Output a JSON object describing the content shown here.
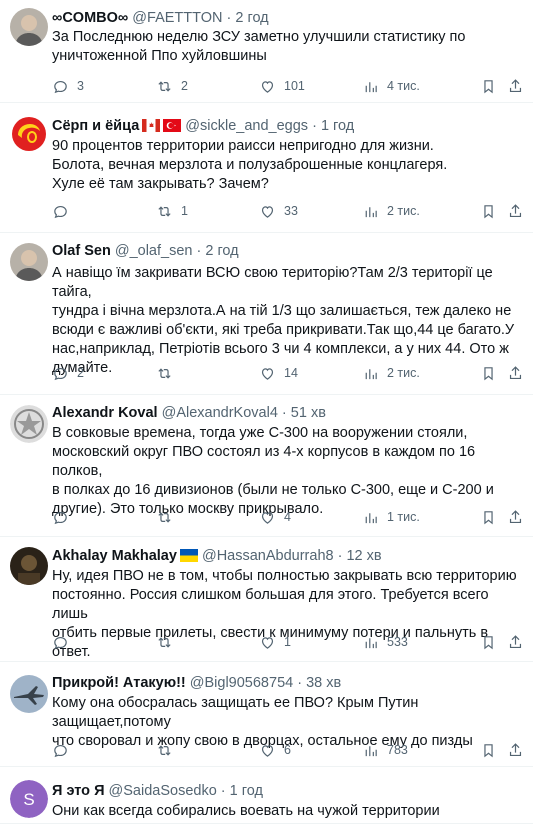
{
  "tweets": [
    {
      "name": "∞COMBO∞",
      "handle": "@FAETTTON",
      "time": "2 год",
      "lines": [
        "За Последнюю неделю ЗСУ заметно улучшили статистику по",
        "уничтоженной Ппо хуйловшины"
      ],
      "replies": "3",
      "reposts": "2",
      "likes": "101",
      "views": "4 тис.",
      "avatar": "person-photo"
    },
    {
      "name": "Сёрп и ёйца",
      "handle": "@sickle_and_eggs",
      "time": "1 год",
      "lines": [
        "90 процентов территории раисси непригодно для жизни.",
        "Болота, вечная мерзлота и полузаброшенные концлагеря.",
        "Хуле её там закрывать? Зачем?"
      ],
      "replies": "",
      "reposts": "1",
      "likes": "33",
      "views": "2 тис.",
      "avatar": "sickle-egg-logo",
      "flags": [
        "canada-flag",
        "turkey-flag"
      ]
    },
    {
      "name": "Olaf Sen",
      "handle": "@_olaf_sen",
      "time": "2 год",
      "lines": [
        "А навіщо їм закривати ВСЮ свою територію?Там 2/3 території це тайга,",
        "тундра і вічна мерзлота.А на тій 1/3 що залишається, теж далеко не",
        "всюди є важливі об'єкти, які треба прикривати.Так що,44 це багато.У",
        "нас,наприклад, Петріотів всього 3 чи 4 комплекси, а у них 44. Ото ж",
        "думайте."
      ],
      "replies": "2",
      "reposts": "",
      "likes": "14",
      "views": "2 тис.",
      "avatar": "person-photo"
    },
    {
      "name": "Alexandr Koval",
      "handle": "@AlexandrKoval4",
      "time": "51 хв",
      "lines": [
        "В совковые времена, тогда уже С-300 на вооружении стояли,",
        "московский округ ПВО состоял из 4-х корпусов в каждом по 16 полков,",
        "в полках до 16 дивизионов (были не только С-300, еще и С-200 и",
        "другие). Это только москву прикрывало."
      ],
      "replies": "",
      "reposts": "",
      "likes": "4",
      "views": "1 тис.",
      "avatar": "emblem"
    },
    {
      "name": "Akhalay Makhalay",
      "handle": "@HassanAbdurrah8",
      "time": "12 хв",
      "lines": [
        "Ну, идея ПВО не в том, чтобы полностью закрывать всю территорию",
        "постоянно. Россия слишком большая для этого. Требуется всего лишь",
        "отбить первые прилеты, свести к минимуму потери и пальнуть в ответ."
      ],
      "replies": "",
      "reposts": "",
      "likes": "1",
      "views": "533",
      "avatar": "dark-photo",
      "flags": [
        "ukraine-flag"
      ]
    },
    {
      "name": "Прикрой! Атакую!!",
      "handle": "@Bigl90568754",
      "time": "38 хв",
      "lines": [
        "Кому она обосралась защищать ее ПВО? Крым Путин защищает,потому",
        "что своровал и жопу свою в дворцах, остальное ему до пизды"
      ],
      "replies": "",
      "reposts": "",
      "likes": "6",
      "views": "783",
      "avatar": "jet-photo"
    },
    {
      "name": "Я это Я",
      "handle": "@SaidaSosedko",
      "time": "1 год",
      "lines": [
        "Они как всегда собирались воевать на чужой территории"
      ],
      "replies": "",
      "reposts": "",
      "likes": "",
      "views": "",
      "avatar": "letter-avatar",
      "avatar_letter": "S"
    }
  ]
}
